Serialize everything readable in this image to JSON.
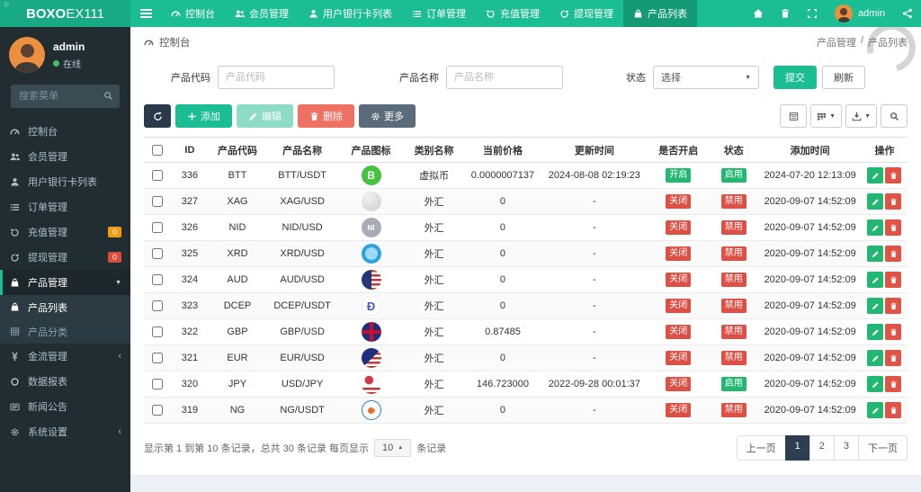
{
  "theme": {
    "green": "#1bbd92",
    "green_dark": "#159a76",
    "logo_green": "#17aa83",
    "sidebar": "#222d32",
    "orange": "#f39c12",
    "red": "#dd4b39",
    "badge_green": "#23b871",
    "badge_red": "#dc5046",
    "page_bg": "#edf1f5",
    "pager_active": "#2e3d50"
  },
  "navbar": {
    "logo_bold": "BOXO",
    "logo_rest": "EX111",
    "username": "admin",
    "corner_mark": "®",
    "items": [
      {
        "key": "dashboard",
        "icon": "gauge",
        "label": "控制台"
      },
      {
        "key": "members",
        "icon": "users",
        "label": "会员管理"
      },
      {
        "key": "user-bank-cards",
        "icon": "user",
        "label": "用户银行卡列表"
      },
      {
        "key": "orders",
        "icon": "list",
        "label": "订单管理"
      },
      {
        "key": "recharge",
        "icon": "undo",
        "label": "充值管理"
      },
      {
        "key": "withdraw",
        "icon": "redo",
        "label": "提现管理"
      },
      {
        "key": "product-list",
        "icon": "bag",
        "label": "产品列表",
        "active": true
      }
    ]
  },
  "sidebar": {
    "username": "admin",
    "status_text": "在线",
    "search_placeholder": "搜索菜单",
    "items": [
      {
        "key": "dashboard",
        "icon": "gauge",
        "label": "控制台"
      },
      {
        "key": "members",
        "icon": "users",
        "label": "会员管理"
      },
      {
        "key": "user-bank-cards",
        "icon": "user",
        "label": "用户银行卡列表"
      },
      {
        "key": "orders",
        "icon": "list",
        "label": "订单管理"
      },
      {
        "key": "recharge",
        "icon": "undo",
        "label": "充值管理",
        "badge": "0",
        "badge_color": "orange"
      },
      {
        "key": "withdraw",
        "icon": "redo",
        "label": "提现管理",
        "badge": "0",
        "badge_color": "red"
      },
      {
        "key": "product-manage",
        "icon": "bag",
        "label": "产品管理",
        "active": true,
        "arrow": "down",
        "children": [
          {
            "key": "product-list",
            "icon": "bag",
            "label": "产品列表",
            "active": true
          },
          {
            "key": "product-category",
            "icon": "grid",
            "label": "产品分类"
          }
        ]
      },
      {
        "key": "finance",
        "icon": "yen",
        "label": "金流管理",
        "arrow": "left"
      },
      {
        "key": "reports",
        "icon": "circle",
        "label": "数据报表"
      },
      {
        "key": "news",
        "icon": "news",
        "label": "新闻公告"
      },
      {
        "key": "settings",
        "icon": "gear",
        "label": "系统设置",
        "arrow": "left"
      }
    ]
  },
  "breadcrumb": {
    "current": "控制台",
    "right_parent": "产品管理",
    "right_sep": "/",
    "right_current": "产品列表"
  },
  "filter": {
    "code_label": "产品代码",
    "code_placeholder": "产品代码",
    "name_label": "产品名称",
    "name_placeholder": "产品名称",
    "status_label": "状态",
    "status_value": "选择",
    "submit_label": "提交",
    "refresh_label": "刷新"
  },
  "toolbar": {
    "add_label": "添加",
    "edit_label": "编辑",
    "delete_label": "删除",
    "more_label": "更多"
  },
  "table": {
    "headers": [
      "ID",
      "产品代码",
      "产品名称",
      "产品图标",
      "类别名称",
      "当前价格",
      "更新时间",
      "是否开启",
      "状态",
      "添加时间",
      "操作"
    ],
    "col_widths": [
      "3.5%",
      "5%",
      "7.5%",
      "9.5%",
      "8.5%",
      "8%",
      "10%",
      "14%",
      "8%",
      "6.5%",
      "13.5%",
      "6%"
    ],
    "rows": [
      {
        "id": "336",
        "code": "BTT",
        "name": "BTT/USDT",
        "icon": {
          "kind": "btt",
          "glyph": "B",
          "bg": "#45c33f",
          "fg": "#ffffff"
        },
        "category": "虚拟币",
        "price": "0.0000007137",
        "updated": "2024-08-08 02:19:23",
        "open": {
          "text": "开启",
          "state": "on"
        },
        "status": {
          "text": "启用",
          "state": "on"
        },
        "added": "2024-07-20 12:13:09"
      },
      {
        "id": "327",
        "code": "XAG",
        "name": "XAG/USD",
        "icon": {
          "kind": "xag"
        },
        "category": "外汇",
        "price": "0",
        "updated": "-",
        "open": {
          "text": "关闭",
          "state": "off"
        },
        "status": {
          "text": "禁用",
          "state": "off"
        },
        "added": "2020-09-07 14:52:09"
      },
      {
        "id": "326",
        "code": "NID",
        "name": "NID/USD",
        "icon": {
          "kind": "nid",
          "glyph": "NI",
          "bg": "#a8adb4",
          "fg": "#ffffff"
        },
        "category": "外汇",
        "price": "0",
        "updated": "-",
        "open": {
          "text": "关闭",
          "state": "off"
        },
        "status": {
          "text": "禁用",
          "state": "off"
        },
        "added": "2020-09-07 14:52:09"
      },
      {
        "id": "325",
        "code": "XRD",
        "name": "XRD/USD",
        "icon": {
          "kind": "xrd"
        },
        "category": "外汇",
        "price": "0",
        "updated": "-",
        "open": {
          "text": "关闭",
          "state": "off"
        },
        "status": {
          "text": "禁用",
          "state": "off"
        },
        "added": "2020-09-07 14:52:09"
      },
      {
        "id": "324",
        "code": "AUD",
        "name": "AUD/USD",
        "icon": {
          "kind": "flag-aud"
        },
        "category": "外汇",
        "price": "0",
        "updated": "-",
        "open": {
          "text": "关闭",
          "state": "off"
        },
        "status": {
          "text": "禁用",
          "state": "off"
        },
        "added": "2020-09-07 14:52:09"
      },
      {
        "id": "323",
        "code": "DCEP",
        "name": "DCEP/USDT",
        "icon": {
          "kind": "dcep",
          "glyph": "Ð",
          "bg": "#ffffff",
          "fg": "#4a56c4"
        },
        "category": "外汇",
        "price": "0",
        "updated": "-",
        "open": {
          "text": "关闭",
          "state": "off"
        },
        "status": {
          "text": "禁用",
          "state": "off"
        },
        "added": "2020-09-07 14:52:09"
      },
      {
        "id": "322",
        "code": "GBP",
        "name": "GBP/USD",
        "icon": {
          "kind": "flag-gbp"
        },
        "category": "外汇",
        "price": "0.87485",
        "updated": "-",
        "open": {
          "text": "关闭",
          "state": "off"
        },
        "status": {
          "text": "禁用",
          "state": "off"
        },
        "added": "2020-09-07 14:52:09"
      },
      {
        "id": "321",
        "code": "EUR",
        "name": "EUR/USD",
        "icon": {
          "kind": "flag-eur"
        },
        "category": "外汇",
        "price": "0",
        "updated": "-",
        "open": {
          "text": "关闭",
          "state": "off"
        },
        "status": {
          "text": "禁用",
          "state": "off"
        },
        "added": "2020-09-07 14:52:09"
      },
      {
        "id": "320",
        "code": "JPY",
        "name": "USD/JPY",
        "icon": {
          "kind": "flag-jpy"
        },
        "category": "外汇",
        "price": "146.723000",
        "updated": "2022-09-28 00:01:37",
        "open": {
          "text": "关闭",
          "state": "off"
        },
        "status": {
          "text": "启用",
          "state": "on"
        },
        "added": "2020-09-07 14:52:09"
      },
      {
        "id": "319",
        "code": "NG",
        "name": "NG/USDT",
        "icon": {
          "kind": "ng",
          "flame": true
        },
        "category": "外汇",
        "price": "0",
        "updated": "-",
        "open": {
          "text": "关闭",
          "state": "off"
        },
        "status": {
          "text": "禁用",
          "state": "off"
        },
        "added": "2020-09-07 14:52:09"
      }
    ]
  },
  "footer": {
    "summary_prefix": "显示第 1 到第 10 条记录，总共 30 条记录 每页显示",
    "page_size": "10",
    "summary_suffix": "条记录",
    "pagination": {
      "prev": "上一页",
      "pages": [
        "1",
        "2",
        "3"
      ],
      "active": "1",
      "next": "下一页"
    }
  }
}
